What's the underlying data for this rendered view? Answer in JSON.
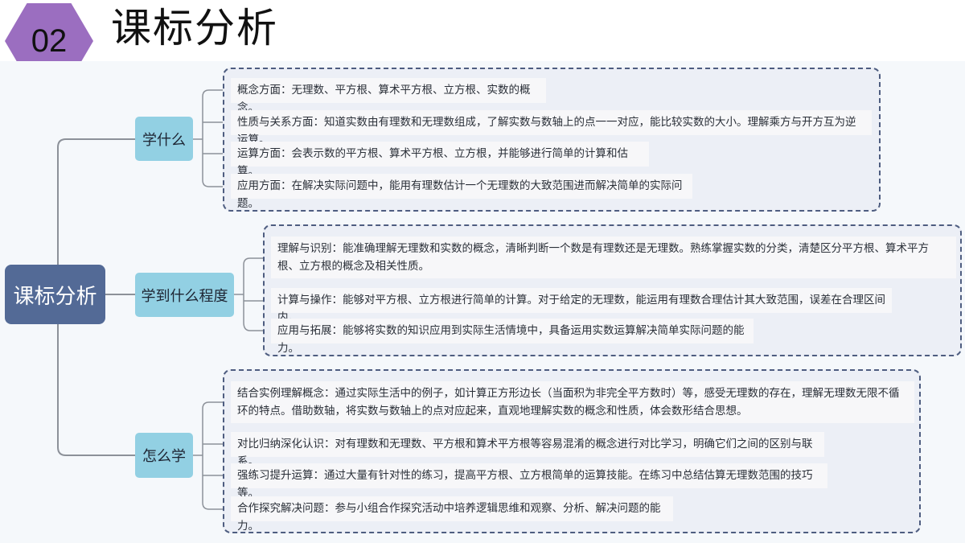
{
  "header": {
    "section_number": "02",
    "title": "课标分析"
  },
  "root": {
    "label": "课标分析"
  },
  "branches": [
    {
      "label": "学什么",
      "items": [
        "概念方面：无理数、平方根、算术平方根、立方根、实数的概念。",
        "性质与关系方面：知道实数由有理数和无理数组成，了解实数与数轴上的点一一对应，能比较实数的大小。理解乘方与开方互为逆运算。",
        "运算方面：会表示数的平方根、算术平方根、立方根，并能够进行简单的计算和估算。",
        "应用方面：在解决实际问题中，能用有理数估计一个无理数的大致范围进而解决简单的实际问题。"
      ]
    },
    {
      "label": "学到什么程度",
      "items": [
        "理解与识别：能准确理解无理数和实数的概念，清晰判断一个数是有理数还是无理数。熟练掌握实数的分类，清楚区分平方根、算术平方根、立方根的概念及相关性质。",
        "计算与操作：能够对平方根、立方根进行简单的计算。对于给定的无理数，能运用有理数合理估计其大致范围，误差在合理区间内。",
        "应用与拓展：能够将实数的知识应用到实际生活情境中，具备运用实数运算解决简单实际问题的能力。"
      ]
    },
    {
      "label": "怎么学",
      "items": [
        "结合实例理解概念：通过实际生活中的例子，如计算正方形边长（当面积为非完全平方数时）等，感受无理数的存在，理解无理数无限不循环的特点。借助数轴，将实数与数轴上的点对应起来，直观地理解实数的概念和性质，体会数形结合思想。",
        "对比归纳深化认识：对有理数和无理数、平方根和算术平方根等容易混淆的概念进行对比学习，明确它们之间的区别与联系。",
        "强练习提升运算：通过大量有针对性的练习，提高平方根、立方根简单的运算技能。在练习中总结估算无理数范围的技巧等。",
        "合作探究解决问题：参与小组合作探究活动中培养逻辑思维和观察、分析、解决问题的能力。"
      ]
    }
  ],
  "colors": {
    "hexagon": "#9b6ec0",
    "root": "#536a96",
    "branch": "#92d0e3",
    "group_border": "#4e5d80",
    "group_fill": "#eceff6",
    "connector": "#8c9199"
  }
}
